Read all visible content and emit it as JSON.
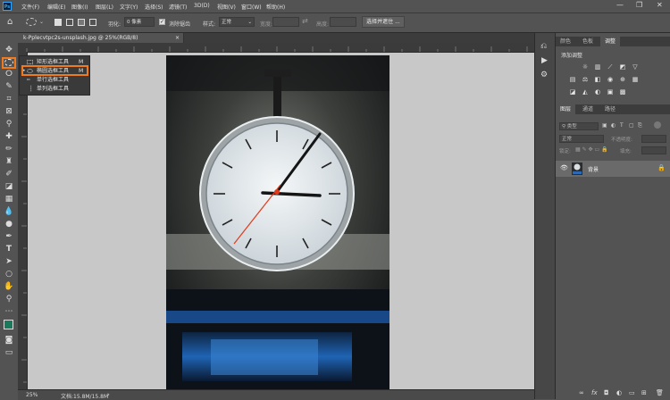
{
  "app": {
    "logo": "Ps",
    "accent": "#31a8ff"
  },
  "menu": [
    "文件(F)",
    "编辑(E)",
    "图像(I)",
    "图层(L)",
    "文字(Y)",
    "选择(S)",
    "滤镜(T)",
    "3D(D)",
    "视图(V)",
    "窗口(W)",
    "帮助(H)"
  ],
  "window_controls": {
    "minimize": "—",
    "restore": "❐",
    "close": "✕"
  },
  "options": {
    "feather_label": "羽化:",
    "feather_value": "0 像素",
    "antialias_label": "消除锯齿",
    "style_label": "样式:",
    "style_value": "正常",
    "width_label": "宽度:",
    "height_label": "高度:",
    "select_mask_button": "选择并遮住 ..."
  },
  "document": {
    "tab_title": "k-Pplecvtpc2s-unsplash.jpg @ 25%(RGB/8)",
    "tab_close": "×"
  },
  "flyout": {
    "items": [
      {
        "label": "矩形选框工具",
        "shortcut": "M"
      },
      {
        "label": "椭圆选框工具",
        "shortcut": "M"
      },
      {
        "label": "单行选框工具",
        "shortcut": ""
      },
      {
        "label": "单列选框工具",
        "shortcut": ""
      }
    ],
    "highlight_color": "#f07a20"
  },
  "status": {
    "zoom": "25%",
    "doc_info": "文档:15.8M/15.8M"
  },
  "panels": {
    "top_tabs": [
      "颜色",
      "色板",
      "调整"
    ],
    "adjust_title": "添加调整",
    "layer_tabs": [
      "图层",
      "通道",
      "路径"
    ],
    "layer_kind_placeholder": "类型",
    "blend_mode": "正常",
    "opacity_label": "不透明度:",
    "lock_label": "锁定:",
    "fill_label": "填充:",
    "layer_name": "背景"
  }
}
